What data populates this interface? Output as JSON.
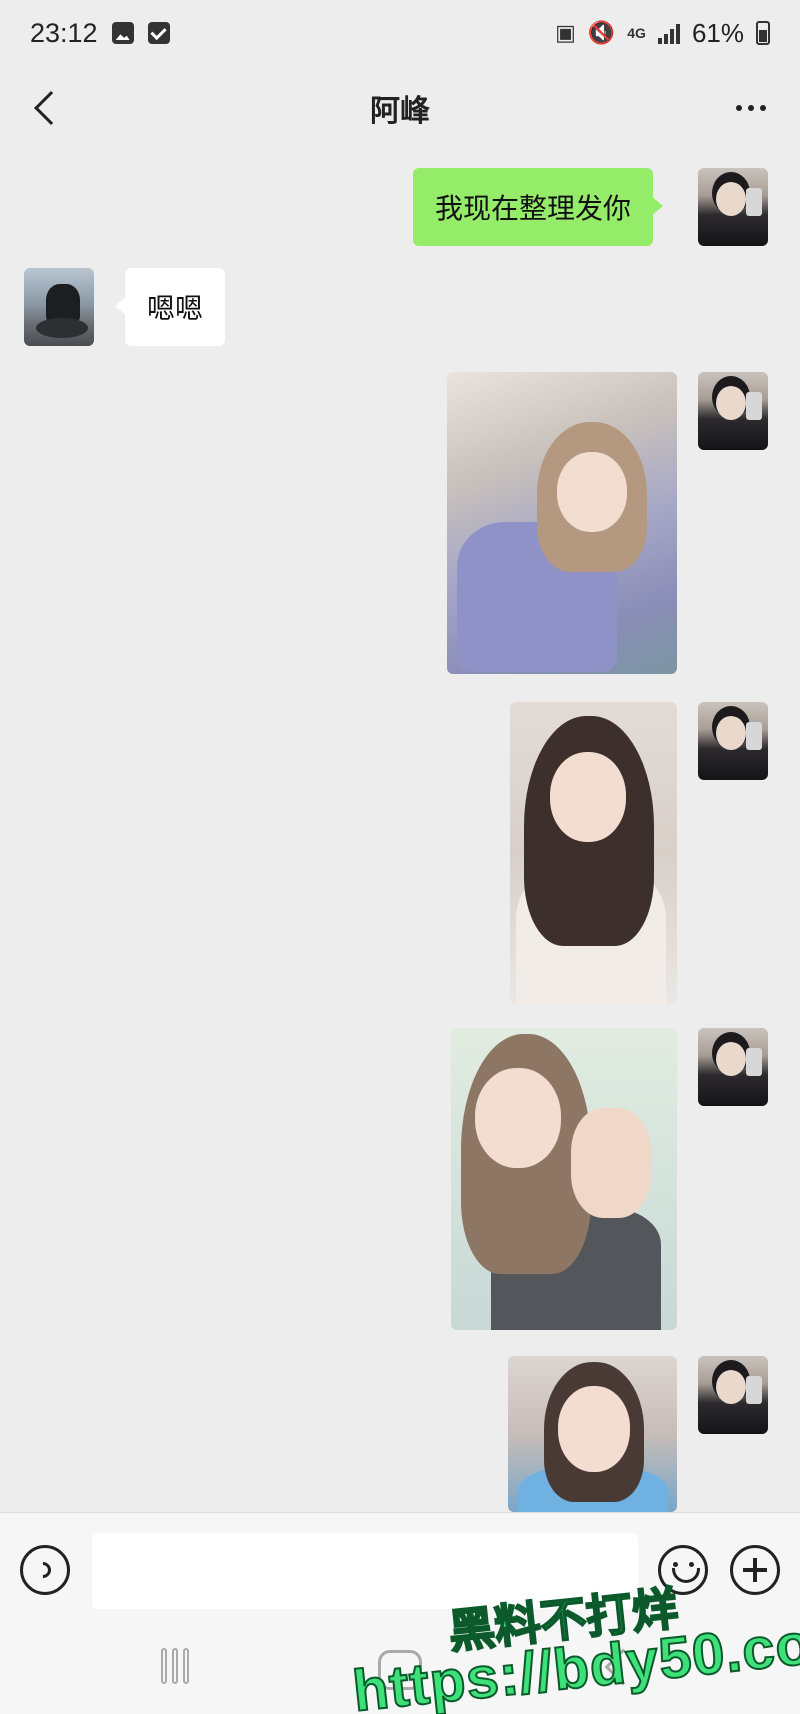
{
  "status_bar": {
    "time": "23:12",
    "network": "4G",
    "battery": "61%"
  },
  "nav": {
    "title": "阿峰"
  },
  "messages": [
    {
      "side": "sent",
      "type": "text",
      "text": "我现在整理发你"
    },
    {
      "side": "received",
      "type": "text",
      "text": "嗯嗯"
    },
    {
      "side": "sent",
      "type": "image"
    },
    {
      "side": "sent",
      "type": "image"
    },
    {
      "side": "sent",
      "type": "image"
    },
    {
      "side": "sent",
      "type": "image"
    }
  ],
  "input_bar": {
    "placeholder": ""
  },
  "watermark": {
    "line1": "黑料不打烊",
    "line2": "https://bdy50.co"
  },
  "colors": {
    "background": "#ededed",
    "sent_bubble": "#95ec69",
    "received_bubble": "#ffffff",
    "watermark": "#3ee07a"
  }
}
